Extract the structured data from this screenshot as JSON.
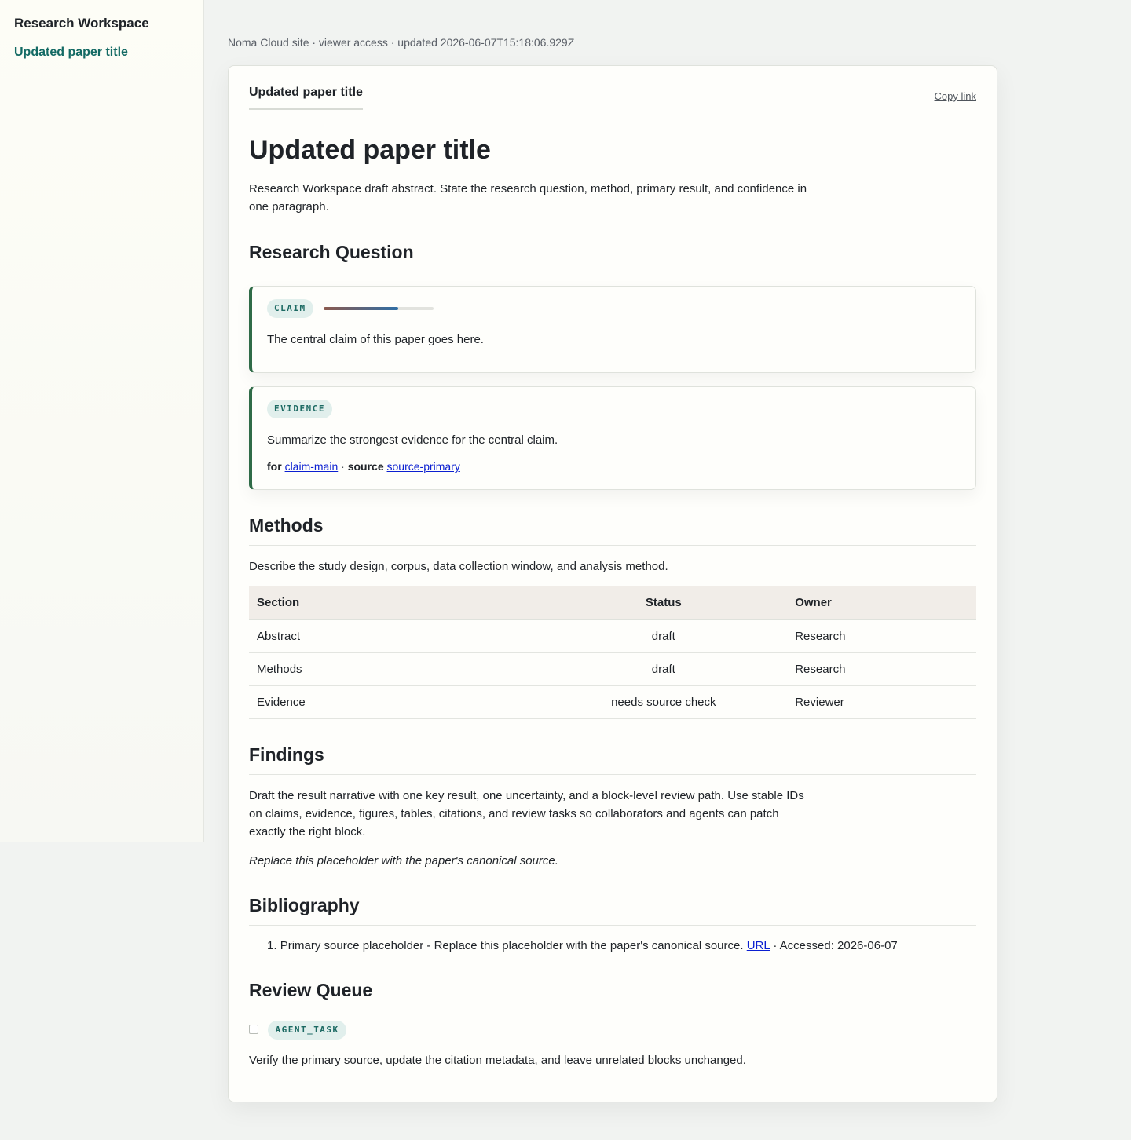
{
  "sidebar": {
    "workspace_title": "Research Workspace",
    "items": [
      {
        "label": "Updated paper title"
      }
    ]
  },
  "meta_line": "Noma Cloud site · viewer access · updated 2026-06-07T15:18:06.929Z",
  "paper": {
    "tab_title": "Updated paper title",
    "copy_link_label": "Copy link",
    "title": "Updated paper title",
    "abstract": "Research Workspace draft abstract. State the research question, method, primary result, and confidence in one paragraph."
  },
  "sections": {
    "research_question": "Research Question",
    "methods": "Methods",
    "findings": "Findings",
    "bibliography": "Bibliography",
    "review_queue": "Review Queue"
  },
  "claim": {
    "tag": "CLAIM",
    "confidence": 0.68,
    "text": "The central claim of this paper goes here."
  },
  "evidence": {
    "tag": "EVIDENCE",
    "text": "Summarize the strongest evidence for the central claim.",
    "for_label": "for",
    "for_link": "claim-main",
    "separator": "·",
    "source_label": "source",
    "source_link": "source-primary"
  },
  "methods": {
    "text": "Describe the study design, corpus, data collection window, and analysis method.",
    "table": {
      "headers": [
        "Section",
        "Status",
        "Owner"
      ],
      "rows": [
        [
          "Abstract",
          "draft",
          "Research"
        ],
        [
          "Methods",
          "draft",
          "Research"
        ],
        [
          "Evidence",
          "needs source check",
          "Reviewer"
        ]
      ]
    }
  },
  "findings": {
    "text": "Draft the result narrative with one key result, one uncertainty, and a block-level review path. Use stable IDs on claims, evidence, figures, tables, citations, and review tasks so collaborators and agents can patch exactly the right block.",
    "note": "Replace this placeholder with the paper's canonical source."
  },
  "bibliography": {
    "entries": [
      {
        "number": "1.",
        "text": "Primary source placeholder - Replace this placeholder with the paper's canonical source.",
        "link": "URL",
        "accessed": "· Accessed: 2026-06-07"
      }
    ]
  },
  "review_queue": {
    "tag": "AGENT_TASK",
    "checked": false,
    "text": "Verify the primary source, update the citation metadata, and leave unrelated blocks unchanged."
  }
}
